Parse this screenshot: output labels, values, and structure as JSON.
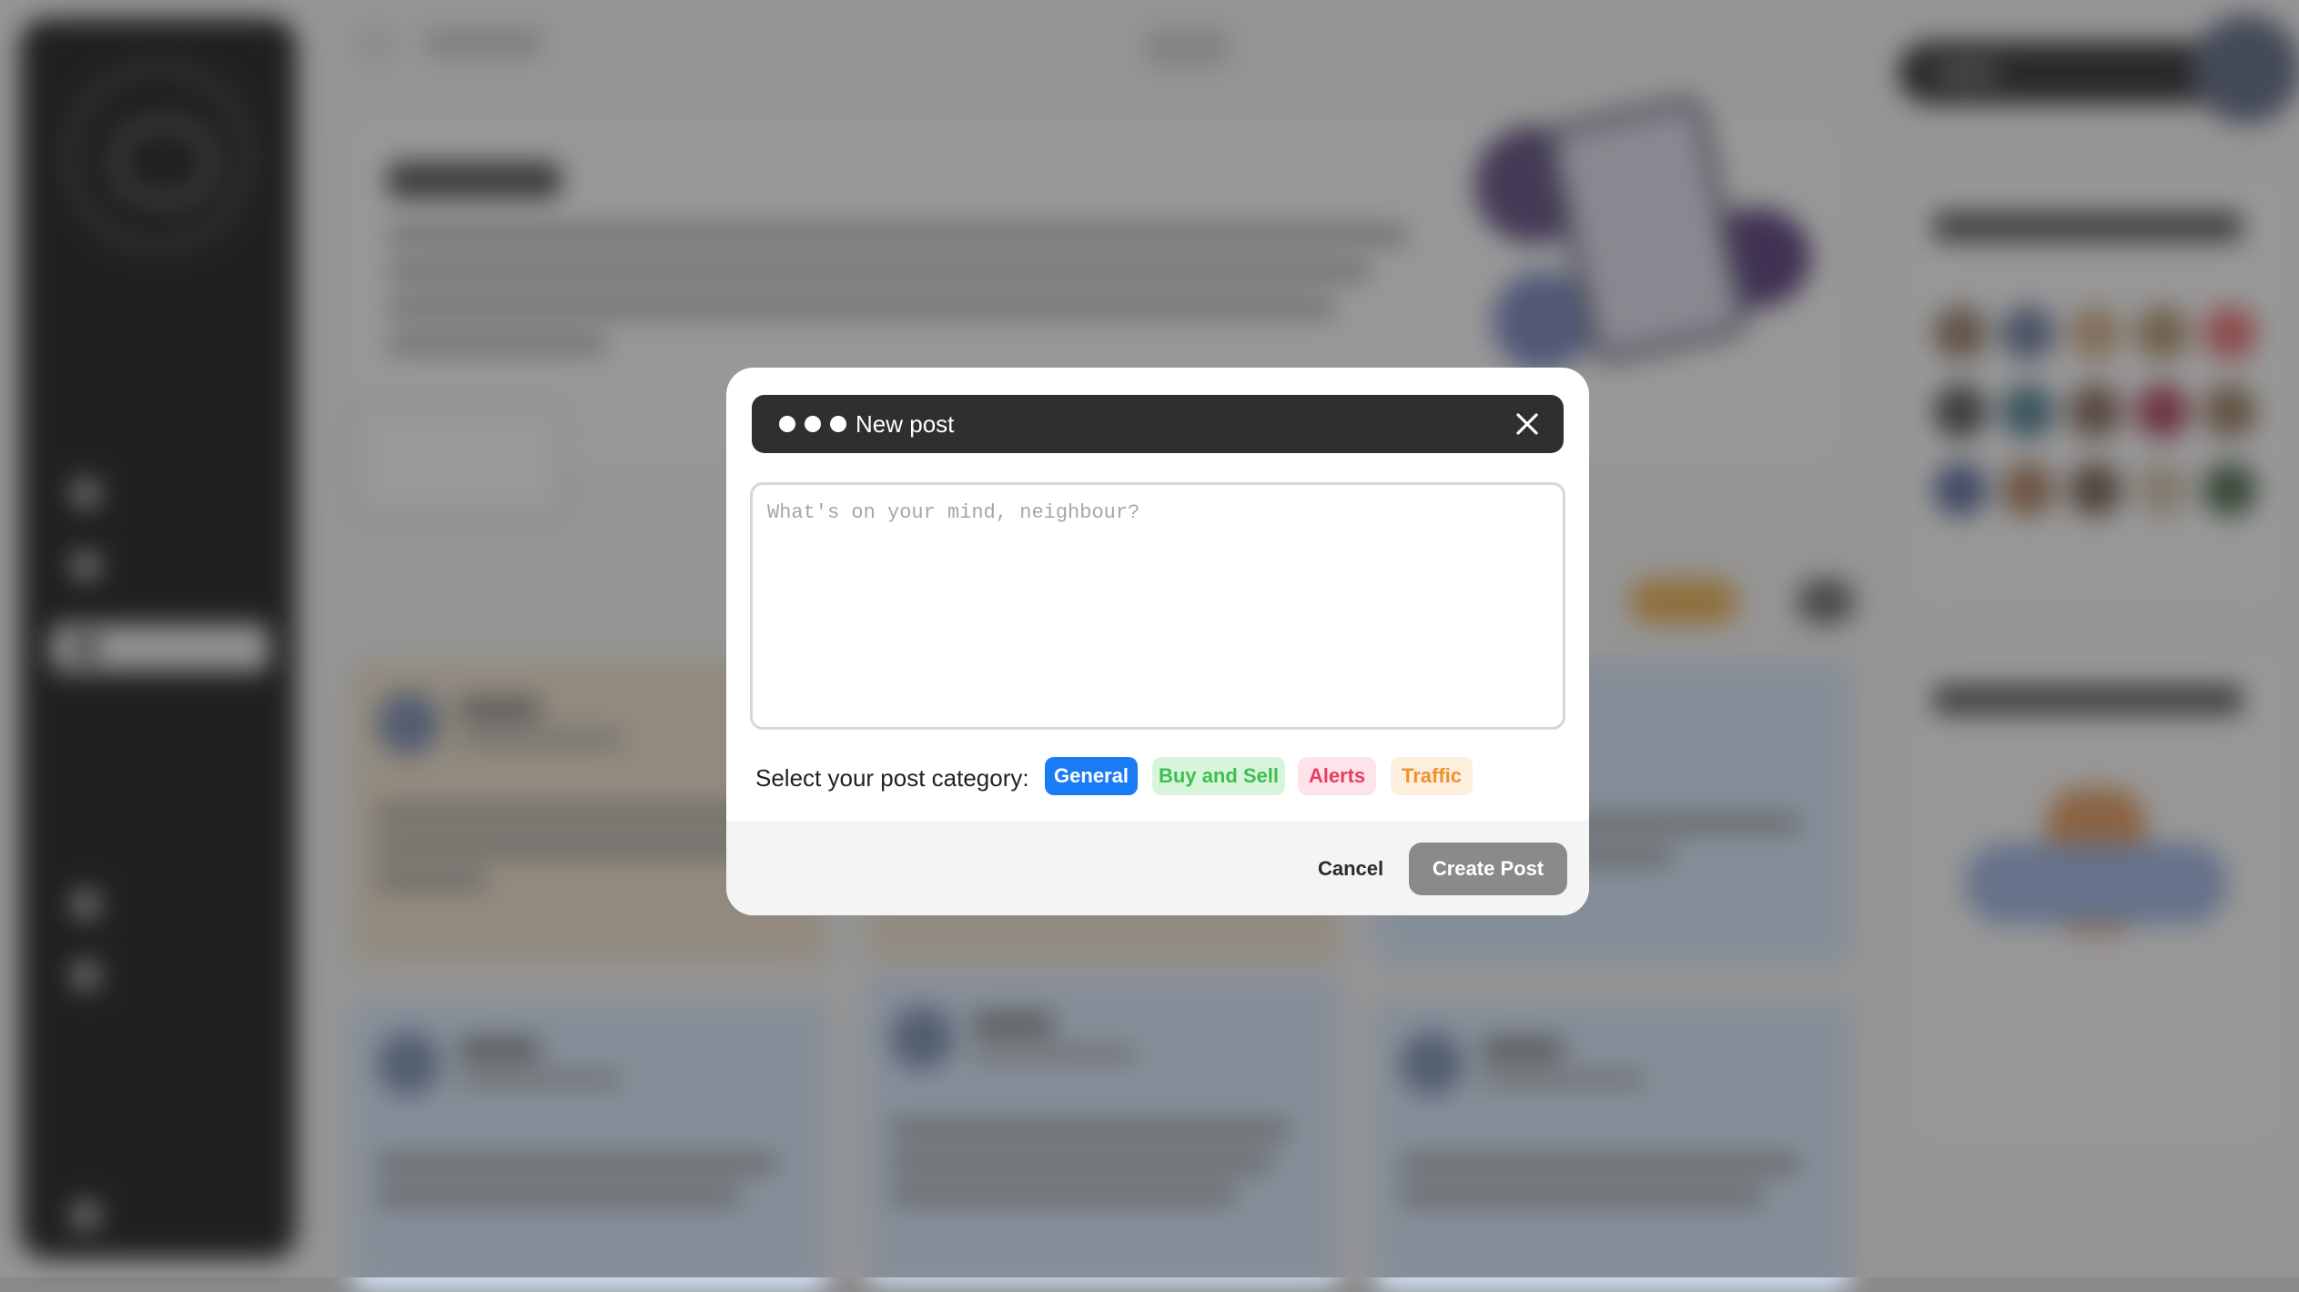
{
  "modal": {
    "title": "New post",
    "placeholder": "What's on your mind, neighbour?",
    "category_prompt": "Select your post category:",
    "categories": [
      {
        "label": "General",
        "selected": true,
        "bg": "#1a7cf5",
        "fg": "#ffffff"
      },
      {
        "label": "Buy and Sell",
        "selected": false,
        "bg": "#d8f5dc",
        "fg": "#3fbf4f"
      },
      {
        "label": "Alerts",
        "selected": false,
        "bg": "#fde3ea",
        "fg": "#ec3b63"
      },
      {
        "label": "Traffic",
        "selected": false,
        "bg": "#fdeede",
        "fg": "#f0922a"
      }
    ],
    "cancel_label": "Cancel",
    "create_label": "Create Post",
    "header_bg": "#2f2f2f"
  },
  "icons": {
    "menu_dots": "more-dots-icon",
    "close": "close-icon"
  }
}
